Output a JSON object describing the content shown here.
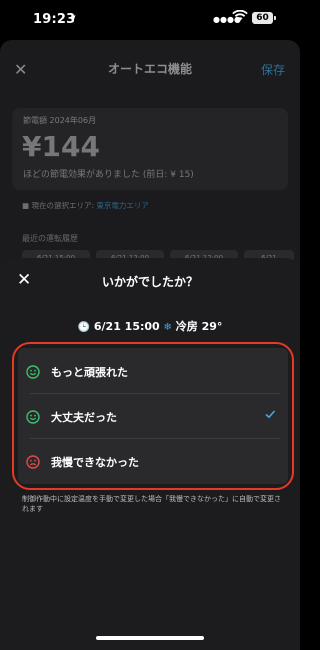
{
  "status": {
    "time": "19:23",
    "battery": "60"
  },
  "background": {
    "title": "オートエコ機能",
    "save": "保存",
    "card_label": "節電額 2024年06月",
    "amount": "¥144",
    "description": "ほどの節電効果がありました (前日: ¥ 15)",
    "area_prefix": "■ 現在の選択エリア: ",
    "area_link": "東京電力エリア",
    "history_label": "最近の運転履歴",
    "chips": [
      "6/21 15:00",
      "6/21 12:00",
      "6/21 12:00",
      "6/21"
    ]
  },
  "modal": {
    "title": "いかがでしたか？",
    "info_datetime": "6/21 15:00",
    "info_mode": "冷房 29°",
    "options": [
      {
        "label": "もっと頑張れた",
        "face": "green-smile",
        "selected": false
      },
      {
        "label": "大丈夫だった",
        "face": "green-smile",
        "selected": true
      },
      {
        "label": "我慢できなかった",
        "face": "red-frown",
        "selected": false
      }
    ],
    "note": "制御作動中に設定温度を手動で変更した場合「我慢できなかった」に自動で変更されます"
  },
  "colors": {
    "accent": "#4aa3df",
    "highlight": "#e53a25",
    "positive": "#39c06b",
    "negative": "#e24a4a"
  }
}
